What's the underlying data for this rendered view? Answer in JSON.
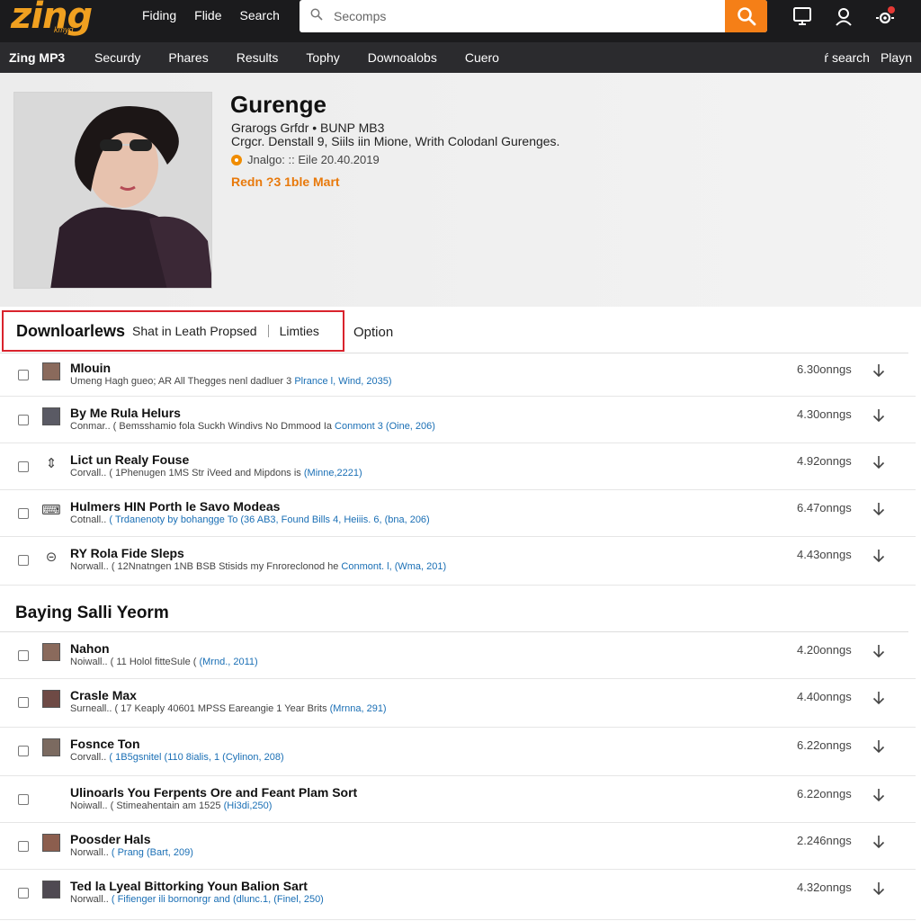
{
  "brand": {
    "logo": "zing",
    "logo_sub": "kmyg",
    "colors": {
      "accent": "#f57f17",
      "highlight": "#d9232d",
      "link": "#1a6fb5"
    }
  },
  "topnav": [
    "Fiding",
    "Flide",
    "Search"
  ],
  "search": {
    "placeholder": "Secomps",
    "icon": "search-icon"
  },
  "top_icons": [
    "monitor-icon",
    "user-icon",
    "settings-icon"
  ],
  "nav2": {
    "brand": "Zing MP3",
    "items": [
      "Securdy",
      "Phares",
      "Results",
      "Tophy",
      "Downoalobs",
      "Cuero"
    ],
    "right": [
      "ŕ search",
      "Playn"
    ]
  },
  "artist": {
    "name": "Gurenge",
    "meta1": "Grarogs Grfdr  •  BUNP MB3",
    "meta2": "Crgcr. Denstall 9, Siils iin Mione, Writh Colodanl Gurenges.",
    "meta3": "Jnalgo: :: Eile 20.40.2019",
    "meta4": "Redn ?3 1ble Mart"
  },
  "tabs": {
    "main": "Downloarlews",
    "sub": "Shat in Leath Propsed",
    "limits": "Limties",
    "option": "Option"
  },
  "list1": [
    {
      "title": "Mlouin",
      "sub": "Umeng Hagh gueo; AR All Thegges nenl dadluer 3 ",
      "link": "Plrance l, Wind, 2035)",
      "size": "6.30onngs",
      "thumb": "photo"
    },
    {
      "title": "By Me Rula Helurs",
      "sub": "Conmar..  ( Bemsshamio fola Suckh Windivs No Dmmood Ia ",
      "link": "Conmont 3 (Oine, 206)",
      "size": "4.30onngs",
      "thumb": "photo"
    },
    {
      "title": "Lict un Realy Fouse",
      "sub": "Corvall..  ( 1Phenugen 1MS Str iVeed and Mipdons is ",
      "link": "(Minne,2221)",
      "size": "4.92onngs",
      "thumb": "glyph",
      "glyph": "⇕"
    },
    {
      "title": "Hulmers HIN Porth le Savo Modeas",
      "sub": "Cotnall..  ",
      "link": "( Trdanenoty by bohangge To (36 AB3, Found Bills 4, Heiiis. 6, (bna, 206)",
      "size": "6.47onngs",
      "thumb": "glyph",
      "glyph": "⌨"
    },
    {
      "title": "RY Rola Fide Sleps",
      "sub": "Norwall..  ( 12Nnatngen 1NB BSB Stisids my Fnroreclonod he ",
      "link": "Conmont. l, (Wma, 201)",
      "size": "4.43onngs",
      "thumb": "glyph",
      "glyph": "⊝"
    }
  ],
  "section2_title": "Baying Salli Yeorm",
  "list2": [
    {
      "title": "Nahon",
      "sub": "Noiwall..  ( 11 Holol fitteSule ( ",
      "link": "(Mrnd., 2011)",
      "size": "4.20onngs",
      "thumb": "photo"
    },
    {
      "title": "Crasle Max",
      "sub": "Surneall..  ( 17 Keaply 40601 MPSS Eareangie 1 Year Brits ",
      "link": "(Mrnna, 291)",
      "size": "4.40onngs",
      "thumb": "photo"
    },
    {
      "title": "Fosnce Ton",
      "sub": "Corvall..  ",
      "link": "( 1B5gsnitel (110 8ialis, 1 (Cylinon, 208)",
      "size": "6.22onngs",
      "thumb": "photo"
    },
    {
      "title": "Ulinoarls You Ferpents Ore and Feant Plam Sort",
      "sub": "Noiwall..  ( Stimeahentain am 1525 ",
      "link": "(Hi3di,250)",
      "size": "6.22onngs",
      "thumb": "none"
    },
    {
      "title": "Poosder Hals",
      "sub": "Norwall..  ",
      "link": "( Prang (Bart, 209)",
      "size": "2.246nngs",
      "thumb": "photo"
    },
    {
      "title": "Ted la Lyeal Bittorking Youn Balion Sart",
      "sub": "Norwall..  ",
      "link": "( Fifienger ili bornonrgr and (dlunc.1, (Finel, 250)",
      "size": "4.32onngs",
      "thumb": "photo"
    }
  ]
}
